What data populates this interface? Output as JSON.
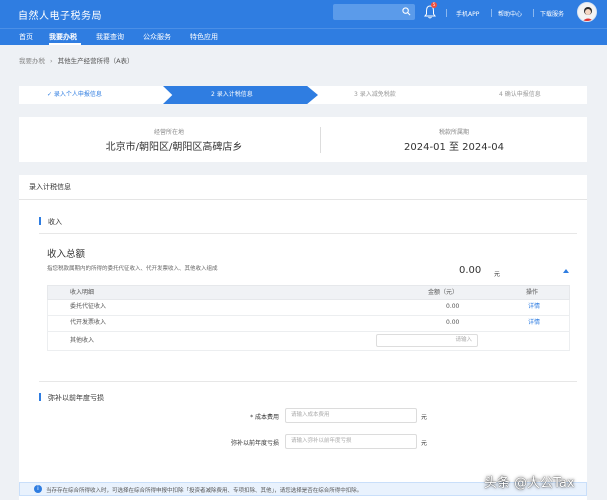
{
  "header": {
    "logo": "自然人电子税务局",
    "links": [
      "手机APP",
      "帮助中心",
      "下载服务"
    ],
    "notification_count": "5"
  },
  "nav": {
    "items": [
      "首页",
      "我要办税",
      "我要查询",
      "公众服务",
      "特色应用"
    ]
  },
  "breadcrumb": {
    "root": "我要办税",
    "current": "其他生产经营所得（A表）"
  },
  "steps": [
    "✓ 录入个人申报信息",
    "2  录入计税信息",
    "3  录入减免税款",
    "4  确认申报信息"
  ],
  "info": {
    "address_label": "经营所在地",
    "address_value": "北京市/朝阳区/朝阳区高碑店乡",
    "period_label": "税款所属期",
    "period_value": "2024-01 至 2024-04"
  },
  "form": {
    "title": "录入计税信息",
    "income_section": "收入",
    "income_total_label": "收入总额",
    "income_desc": "指您税款属期内的所得的委托代征收入、代开发票收入、其他收入组成",
    "income_amount": "0.00",
    "income_unit": "元",
    "table": {
      "headers": [
        "收入明细",
        "金额（元）",
        "操作"
      ],
      "rows": [
        {
          "name": "委托代征收入",
          "amount": "0.00",
          "action": "详情"
        },
        {
          "name": "代开发票收入",
          "amount": "0.00",
          "action": "详情"
        }
      ],
      "other_row_name": "其他收入",
      "other_placeholder": "请输入"
    },
    "loss_section": "弥补以前年度亏损",
    "cost_label": "* 成本费用",
    "cost_placeholder": "请输入成本费用",
    "loss_label": "弥补以前年度亏损",
    "loss_placeholder": "请输入弥补以前年度亏损",
    "unit": "元"
  },
  "notice": {
    "icon": "i",
    "text": "当存存在综合所得收入时，可选择在综合所得申报中扣除「投资者减除费用、专项扣除、其他」，请您选择是否在综合所得中扣除。"
  },
  "watermark": "头条 @大公Tax",
  "colors": {
    "primary": "#2f7de1",
    "notice_bg": "#e9f2fd",
    "badge": "#f04f3f"
  }
}
